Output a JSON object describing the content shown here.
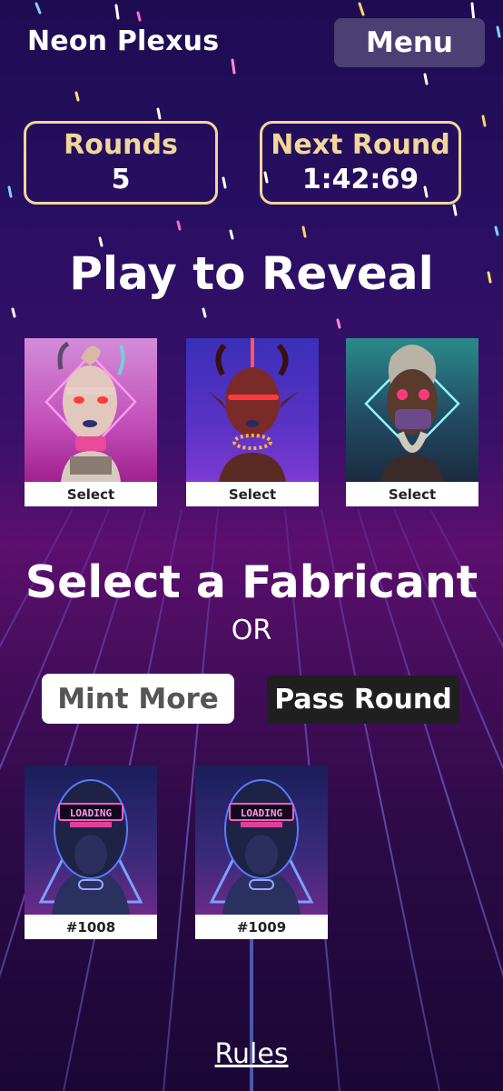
{
  "header": {
    "app_title": "Neon Plexus",
    "menu_label": "Menu"
  },
  "stats": {
    "rounds_label": "Rounds",
    "rounds_value": "5",
    "next_round_label": "Next Round",
    "next_round_value": "1:42:69"
  },
  "reveal": {
    "heading": "Play to Reveal",
    "cards": [
      {
        "select_label": "Select",
        "icon": "fabricant-portrait-pink"
      },
      {
        "select_label": "Select",
        "icon": "fabricant-portrait-red"
      },
      {
        "select_label": "Select",
        "icon": "fabricant-portrait-teal"
      }
    ]
  },
  "choice": {
    "heading": "Select a Fabricant",
    "or_text": "OR",
    "mint_label": "Mint More",
    "pass_label": "Pass Round"
  },
  "owned": {
    "items": [
      {
        "id_label": "#1008",
        "screen_text": "LOADING",
        "icon": "loading-fabricant-portrait"
      },
      {
        "id_label": "#1009",
        "screen_text": "LOADING",
        "icon": "loading-fabricant-portrait"
      }
    ]
  },
  "footer": {
    "rules_label": "Rules"
  },
  "colors": {
    "accent_gold": "#f1d79b",
    "menu_bg": "#4b3f73",
    "pass_bg": "#1f1f1f"
  }
}
